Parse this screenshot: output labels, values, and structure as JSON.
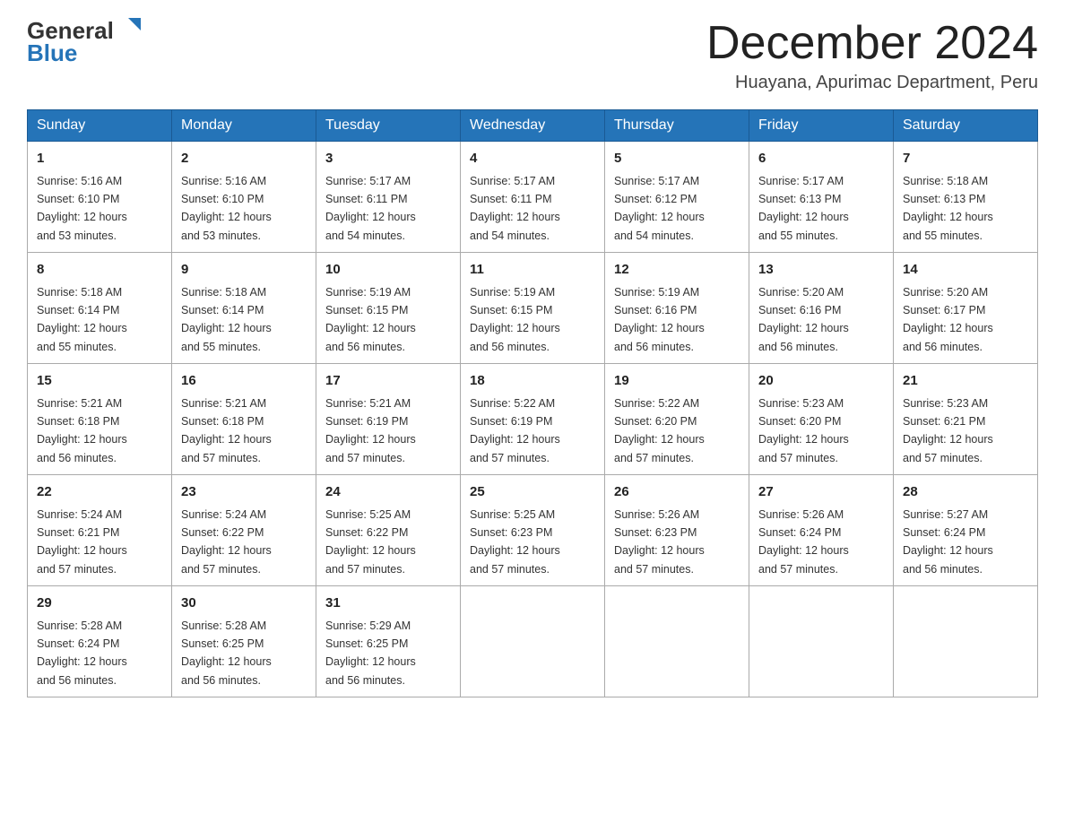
{
  "header": {
    "logo_general": "General",
    "logo_blue": "Blue",
    "month_title": "December 2024",
    "location": "Huayana, Apurimac Department, Peru"
  },
  "weekdays": [
    "Sunday",
    "Monday",
    "Tuesday",
    "Wednesday",
    "Thursday",
    "Friday",
    "Saturday"
  ],
  "weeks": [
    [
      {
        "day": "1",
        "sunrise": "5:16 AM",
        "sunset": "6:10 PM",
        "daylight": "12 hours and 53 minutes."
      },
      {
        "day": "2",
        "sunrise": "5:16 AM",
        "sunset": "6:10 PM",
        "daylight": "12 hours and 53 minutes."
      },
      {
        "day": "3",
        "sunrise": "5:17 AM",
        "sunset": "6:11 PM",
        "daylight": "12 hours and 54 minutes."
      },
      {
        "day": "4",
        "sunrise": "5:17 AM",
        "sunset": "6:11 PM",
        "daylight": "12 hours and 54 minutes."
      },
      {
        "day": "5",
        "sunrise": "5:17 AM",
        "sunset": "6:12 PM",
        "daylight": "12 hours and 54 minutes."
      },
      {
        "day": "6",
        "sunrise": "5:17 AM",
        "sunset": "6:13 PM",
        "daylight": "12 hours and 55 minutes."
      },
      {
        "day": "7",
        "sunrise": "5:18 AM",
        "sunset": "6:13 PM",
        "daylight": "12 hours and 55 minutes."
      }
    ],
    [
      {
        "day": "8",
        "sunrise": "5:18 AM",
        "sunset": "6:14 PM",
        "daylight": "12 hours and 55 minutes."
      },
      {
        "day": "9",
        "sunrise": "5:18 AM",
        "sunset": "6:14 PM",
        "daylight": "12 hours and 55 minutes."
      },
      {
        "day": "10",
        "sunrise": "5:19 AM",
        "sunset": "6:15 PM",
        "daylight": "12 hours and 56 minutes."
      },
      {
        "day": "11",
        "sunrise": "5:19 AM",
        "sunset": "6:15 PM",
        "daylight": "12 hours and 56 minutes."
      },
      {
        "day": "12",
        "sunrise": "5:19 AM",
        "sunset": "6:16 PM",
        "daylight": "12 hours and 56 minutes."
      },
      {
        "day": "13",
        "sunrise": "5:20 AM",
        "sunset": "6:16 PM",
        "daylight": "12 hours and 56 minutes."
      },
      {
        "day": "14",
        "sunrise": "5:20 AM",
        "sunset": "6:17 PM",
        "daylight": "12 hours and 56 minutes."
      }
    ],
    [
      {
        "day": "15",
        "sunrise": "5:21 AM",
        "sunset": "6:18 PM",
        "daylight": "12 hours and 56 minutes."
      },
      {
        "day": "16",
        "sunrise": "5:21 AM",
        "sunset": "6:18 PM",
        "daylight": "12 hours and 57 minutes."
      },
      {
        "day": "17",
        "sunrise": "5:21 AM",
        "sunset": "6:19 PM",
        "daylight": "12 hours and 57 minutes."
      },
      {
        "day": "18",
        "sunrise": "5:22 AM",
        "sunset": "6:19 PM",
        "daylight": "12 hours and 57 minutes."
      },
      {
        "day": "19",
        "sunrise": "5:22 AM",
        "sunset": "6:20 PM",
        "daylight": "12 hours and 57 minutes."
      },
      {
        "day": "20",
        "sunrise": "5:23 AM",
        "sunset": "6:20 PM",
        "daylight": "12 hours and 57 minutes."
      },
      {
        "day": "21",
        "sunrise": "5:23 AM",
        "sunset": "6:21 PM",
        "daylight": "12 hours and 57 minutes."
      }
    ],
    [
      {
        "day": "22",
        "sunrise": "5:24 AM",
        "sunset": "6:21 PM",
        "daylight": "12 hours and 57 minutes."
      },
      {
        "day": "23",
        "sunrise": "5:24 AM",
        "sunset": "6:22 PM",
        "daylight": "12 hours and 57 minutes."
      },
      {
        "day": "24",
        "sunrise": "5:25 AM",
        "sunset": "6:22 PM",
        "daylight": "12 hours and 57 minutes."
      },
      {
        "day": "25",
        "sunrise": "5:25 AM",
        "sunset": "6:23 PM",
        "daylight": "12 hours and 57 minutes."
      },
      {
        "day": "26",
        "sunrise": "5:26 AM",
        "sunset": "6:23 PM",
        "daylight": "12 hours and 57 minutes."
      },
      {
        "day": "27",
        "sunrise": "5:26 AM",
        "sunset": "6:24 PM",
        "daylight": "12 hours and 57 minutes."
      },
      {
        "day": "28",
        "sunrise": "5:27 AM",
        "sunset": "6:24 PM",
        "daylight": "12 hours and 56 minutes."
      }
    ],
    [
      {
        "day": "29",
        "sunrise": "5:28 AM",
        "sunset": "6:24 PM",
        "daylight": "12 hours and 56 minutes."
      },
      {
        "day": "30",
        "sunrise": "5:28 AM",
        "sunset": "6:25 PM",
        "daylight": "12 hours and 56 minutes."
      },
      {
        "day": "31",
        "sunrise": "5:29 AM",
        "sunset": "6:25 PM",
        "daylight": "12 hours and 56 minutes."
      },
      null,
      null,
      null,
      null
    ]
  ],
  "labels": {
    "sunrise": "Sunrise:",
    "sunset": "Sunset:",
    "daylight": "Daylight:"
  }
}
